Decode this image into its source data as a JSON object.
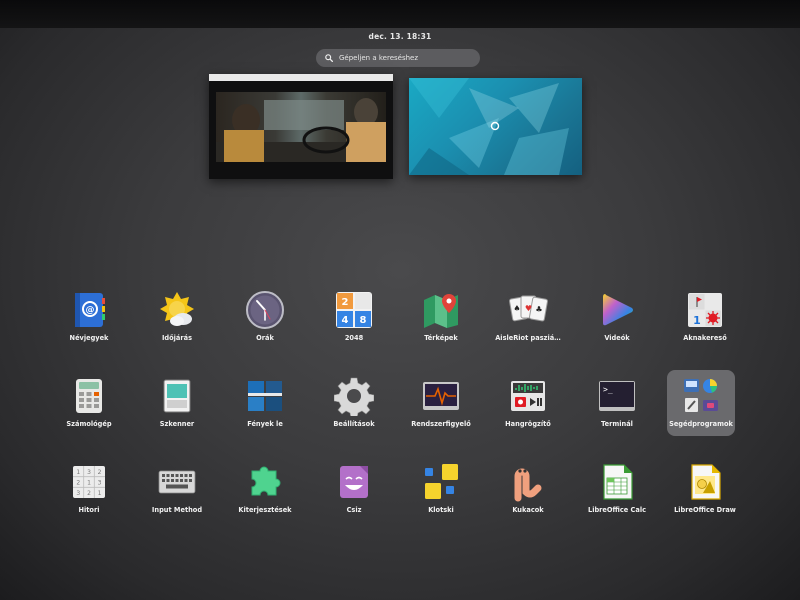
{
  "topbar": {
    "clock": "dec. 13.  18:31"
  },
  "search": {
    "placeholder": "Gépeljen a kereséshez"
  },
  "colors": {
    "background": "#3b3b3d",
    "accent_blue": "#3584e4",
    "search_bg": "#5c5c5f"
  },
  "apps": [
    {
      "label": "Névjegyek",
      "icon": "contacts-icon"
    },
    {
      "label": "Időjárás",
      "icon": "weather-icon"
    },
    {
      "label": "Órák",
      "icon": "clock-icon"
    },
    {
      "label": "2048",
      "icon": "game-2048-icon"
    },
    {
      "label": "Térképek",
      "icon": "maps-icon"
    },
    {
      "label": "AisleRiot pasziá…",
      "icon": "cards-icon"
    },
    {
      "label": "Videók",
      "icon": "videos-icon"
    },
    {
      "label": "Aknakereső",
      "icon": "mines-icon"
    },
    {
      "label": "Számológép",
      "icon": "calculator-icon"
    },
    {
      "label": "Szkenner",
      "icon": "scanner-icon"
    },
    {
      "label": "Fények le",
      "icon": "lightsoff-icon"
    },
    {
      "label": "Beállítások",
      "icon": "settings-gear-icon"
    },
    {
      "label": "Rendszerfigyelő",
      "icon": "system-monitor-icon"
    },
    {
      "label": "Hangrögzítő",
      "icon": "sound-recorder-icon"
    },
    {
      "label": "Terminál",
      "icon": "terminal-icon"
    },
    {
      "label": "Segédprogramok",
      "icon": "utilities-folder-icon"
    },
    {
      "label": "Hitori",
      "icon": "hitori-icon"
    },
    {
      "label": "Input Method",
      "icon": "keyboard-icon"
    },
    {
      "label": "Kiterjesztések",
      "icon": "puzzle-icon"
    },
    {
      "label": "Csiz",
      "icon": "csiz-face-icon"
    },
    {
      "label": "Klotski",
      "icon": "klotski-icon"
    },
    {
      "label": "Kukacok",
      "icon": "worm-icon"
    },
    {
      "label": "LibreOffice Calc",
      "icon": "libreoffice-calc-icon"
    },
    {
      "label": "LibreOffice Draw",
      "icon": "libreoffice-draw-icon"
    }
  ]
}
